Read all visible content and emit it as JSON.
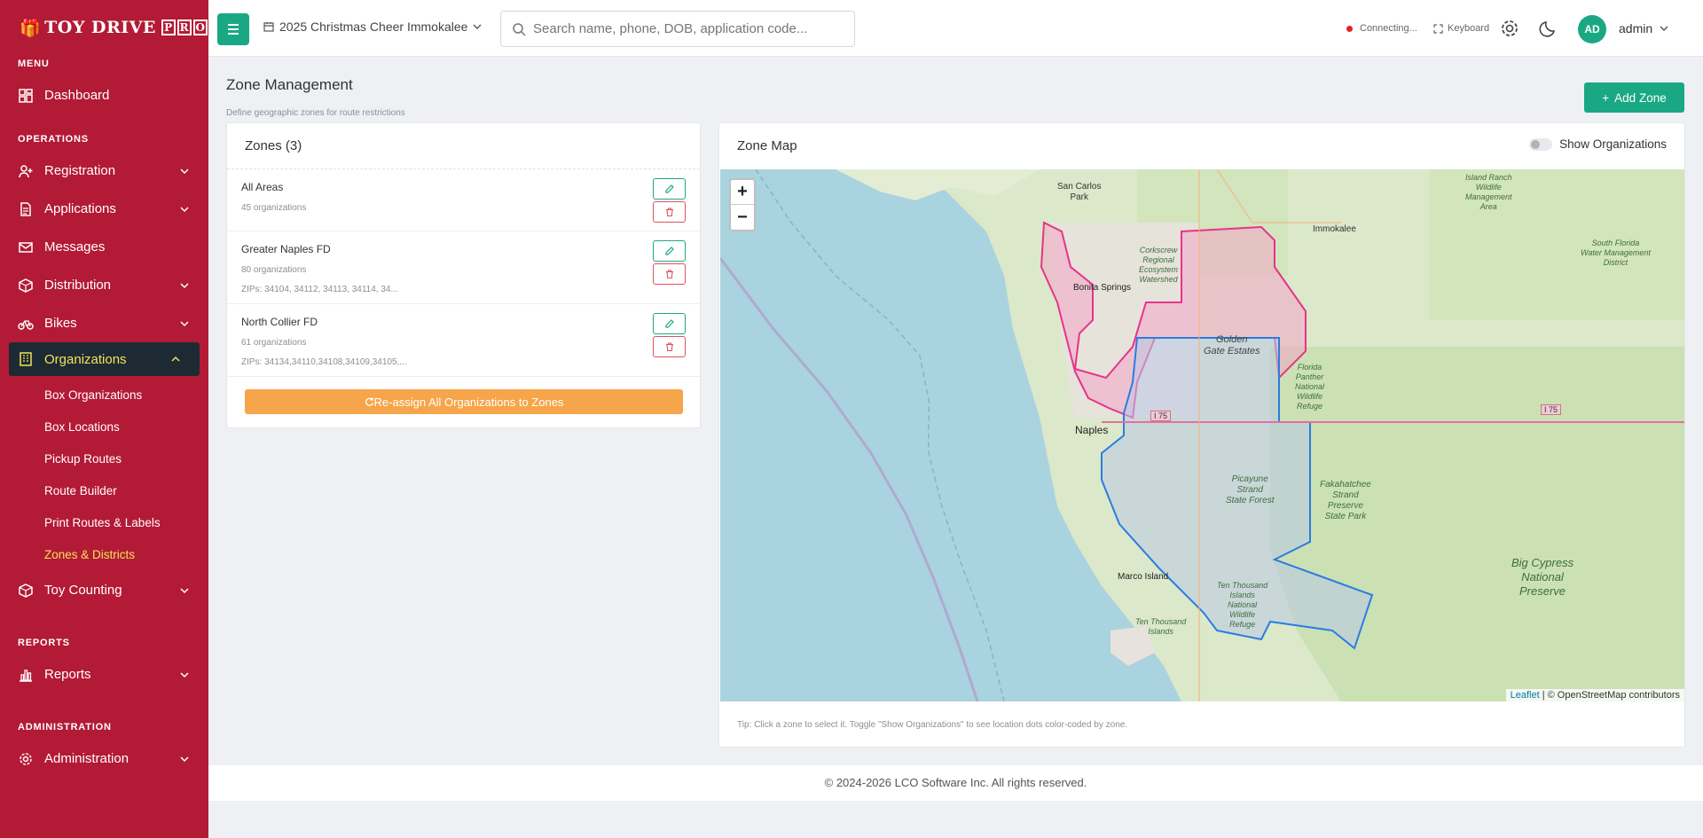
{
  "app": {
    "logo_text": "TOY DRIVE",
    "logo_pro": [
      "P",
      "R",
      "O"
    ]
  },
  "sidebar": {
    "sections": {
      "menu": "MENU",
      "operations": "OPERATIONS",
      "reports": "REPORTS",
      "administration": "ADMINISTRATION"
    },
    "items": {
      "dashboard": "Dashboard",
      "registration": "Registration",
      "applications": "Applications",
      "messages": "Messages",
      "distribution": "Distribution",
      "bikes": "Bikes",
      "organizations": "Organizations",
      "toy_counting": "Toy Counting",
      "reports": "Reports",
      "administration": "Administration"
    },
    "sub_items": [
      "Box Organizations",
      "Box Locations",
      "Pickup Routes",
      "Route Builder",
      "Print Routes & Labels",
      "Zones & Districts"
    ],
    "active_sub": "Zones & Districts"
  },
  "header": {
    "campaign": "2025 Christmas Cheer Immokalee",
    "search_placeholder": "Search name, phone, DOB, application code...",
    "status": "Connecting...",
    "keyboard": "Keyboard",
    "avatar_initials": "AD",
    "username": "admin"
  },
  "page": {
    "title": "Zone Management",
    "subtitle": "Define geographic zones for route restrictions",
    "add_button": "Add Zone"
  },
  "zones": {
    "title": "Zones (3)",
    "items": [
      {
        "name": "All Areas",
        "orgs": "45 organizations",
        "zips": ""
      },
      {
        "name": "Greater Naples FD",
        "orgs": "80 organizations",
        "zips": "ZIPs: 34104, 34112, 34113, 34114, 34..."
      },
      {
        "name": "North Collier FD",
        "orgs": "61 organizations",
        "zips": "ZIPs: 34134,34110,34108,34109,34105,..."
      }
    ],
    "reassign_button": "Re-assign All Organizations to Zones"
  },
  "map": {
    "title": "Zone Map",
    "toggle_label": "Show Organizations",
    "zoom_in": "+",
    "zoom_out": "−",
    "attribution_leaflet": "Leaflet",
    "attribution_osm": "| © OpenStreetMap contributors",
    "tip": "Tip: Click a zone to select it. Toggle \"Show Organizations\" to see location dots color-coded by zone.",
    "labels": {
      "san_carlos": "San Carlos",
      "park": "Park",
      "immokalee": "Immokalee",
      "bonita": "Bonita Springs",
      "corkscrew": "Corkscrew",
      "regional": "Regional",
      "ecosystem": "Ecosystem",
      "watershed": "Watershed",
      "golden1": "Golden",
      "golden2": "Gate Estates",
      "naples": "Naples",
      "i75a": "I 75",
      "i75b": "I 75",
      "florida1": "Florida",
      "florida2": "Panther",
      "florida3": "National",
      "florida4": "Wildlife",
      "florida5": "Refuge",
      "pic1": "Picayune",
      "pic2": "Strand",
      "pic3": "State Forest",
      "fak1": "Fakahatchee",
      "fak2": "Strand",
      "fak3": "Preserve",
      "fak4": "State Park",
      "bc1": "Big Cypress",
      "bc2": "National",
      "bc3": "Preserve",
      "marco": "Marco Island",
      "ttia": "Ten Thousand",
      "ttib": "Islands",
      "tti1": "Ten Thousand",
      "tti2": "Islands",
      "tti3": "National",
      "tti4": "Wildlife",
      "tti5": "Refuge",
      "ir1": "Island Ranch",
      "ir2": "Wildlife",
      "ir3": "Management",
      "ir4": "Area",
      "sf1": "South Florida",
      "sf2": "Water Management",
      "sf3": "District"
    }
  },
  "footer": "© 2024-2026 LCO Software Inc. All rights reserved.",
  "colors": {
    "sidebar": "#b31a35",
    "accent": "#1aa884",
    "active_text": "#f2e35a",
    "reassign": "#f6a54a",
    "zone_pink": "#e8338a",
    "zone_blue": "#2a7de1"
  }
}
